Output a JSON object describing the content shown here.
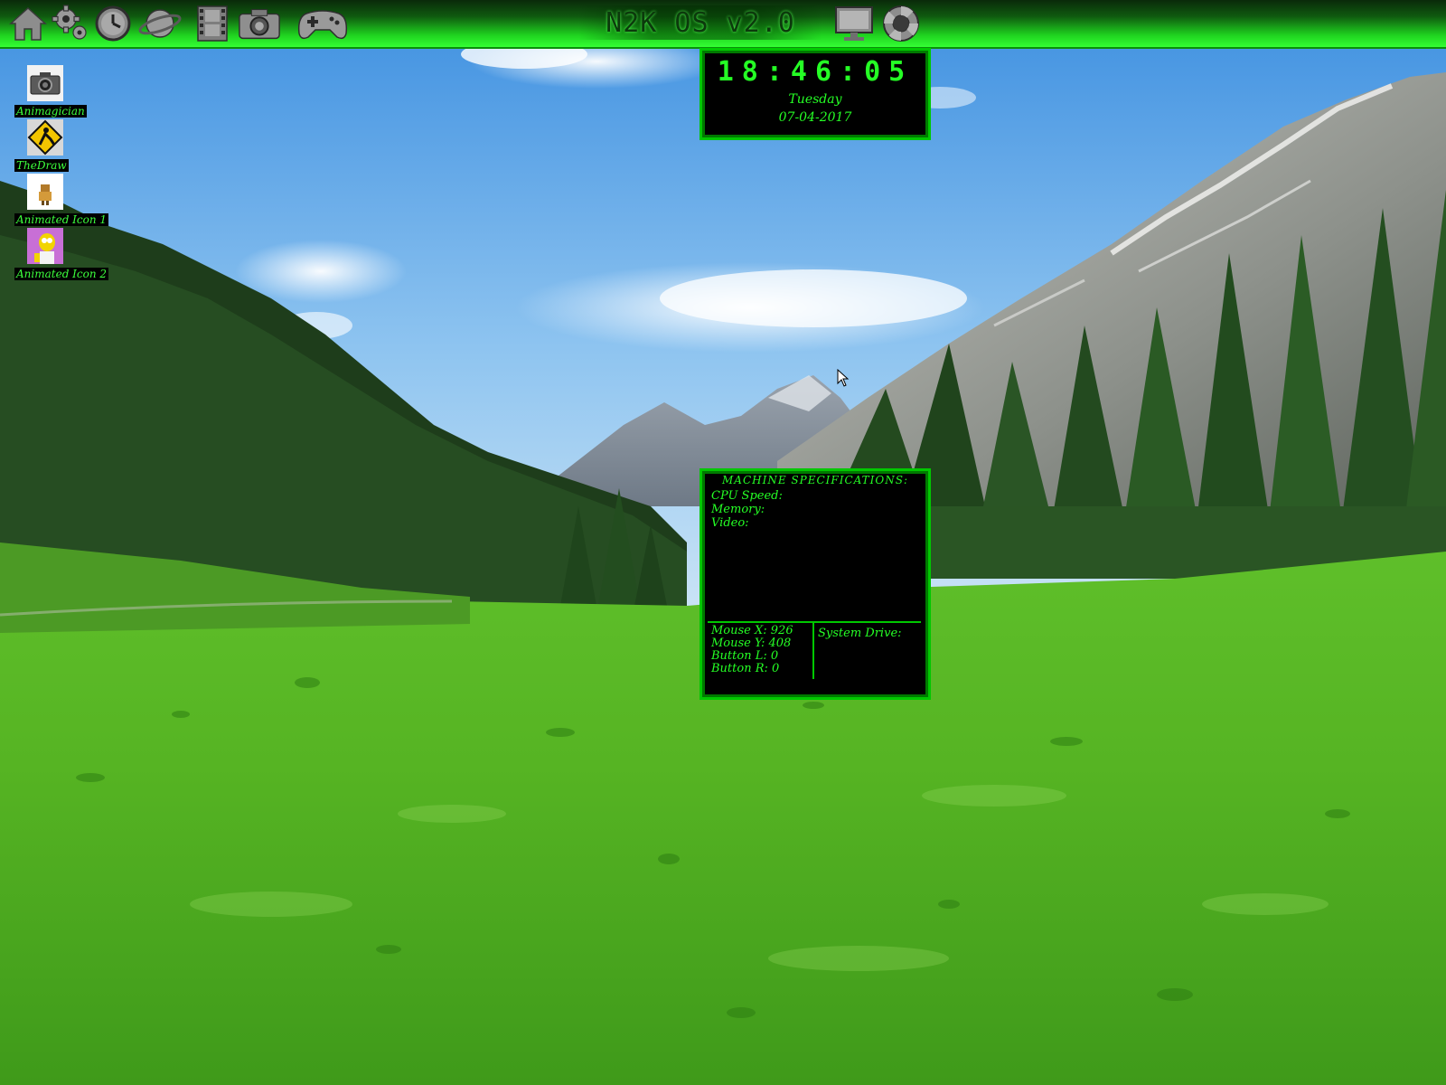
{
  "os": {
    "title": "N2K OS v2.0"
  },
  "topbar": {
    "icons": [
      {
        "name": "home-icon",
        "label": "Home"
      },
      {
        "name": "gear-icon",
        "label": "Settings"
      },
      {
        "name": "clock-icon",
        "label": "Clock"
      },
      {
        "name": "planet-icon",
        "label": "Internet"
      },
      {
        "name": "film-icon",
        "label": "Video"
      },
      {
        "name": "camera-icon",
        "label": "Camera"
      },
      {
        "name": "gamepad-icon",
        "label": "Games"
      },
      {
        "name": "monitor-icon",
        "label": "Display"
      },
      {
        "name": "lifebuoy-icon",
        "label": "Help"
      }
    ]
  },
  "desktop": {
    "icons": [
      {
        "label": "Animagician",
        "icon": "camera-icon"
      },
      {
        "label": "TheDraw",
        "icon": "construction-sign-icon"
      },
      {
        "label": "Animated Icon 1",
        "icon": "small-character-icon"
      },
      {
        "label": "Animated Icon 2",
        "icon": "cartoon-character-icon"
      }
    ]
  },
  "clock": {
    "time": "18:46:05",
    "day": "Tuesday",
    "date": "07-04-2017"
  },
  "specs": {
    "title": "MACHINE SPECIFICATIONS:",
    "cpu_label": "CPU Speed:",
    "memory_label": "Memory:",
    "video_label": "Video:",
    "mouse_x": "Mouse X: 926",
    "mouse_y": "Mouse Y: 408",
    "button_l": "Button L: 0",
    "button_r": "Button R: 0",
    "system_drive_label": "System Drive:"
  },
  "colors": {
    "accent_green": "#25ff25",
    "border_green": "#00c800",
    "panel_bg": "#000000"
  }
}
